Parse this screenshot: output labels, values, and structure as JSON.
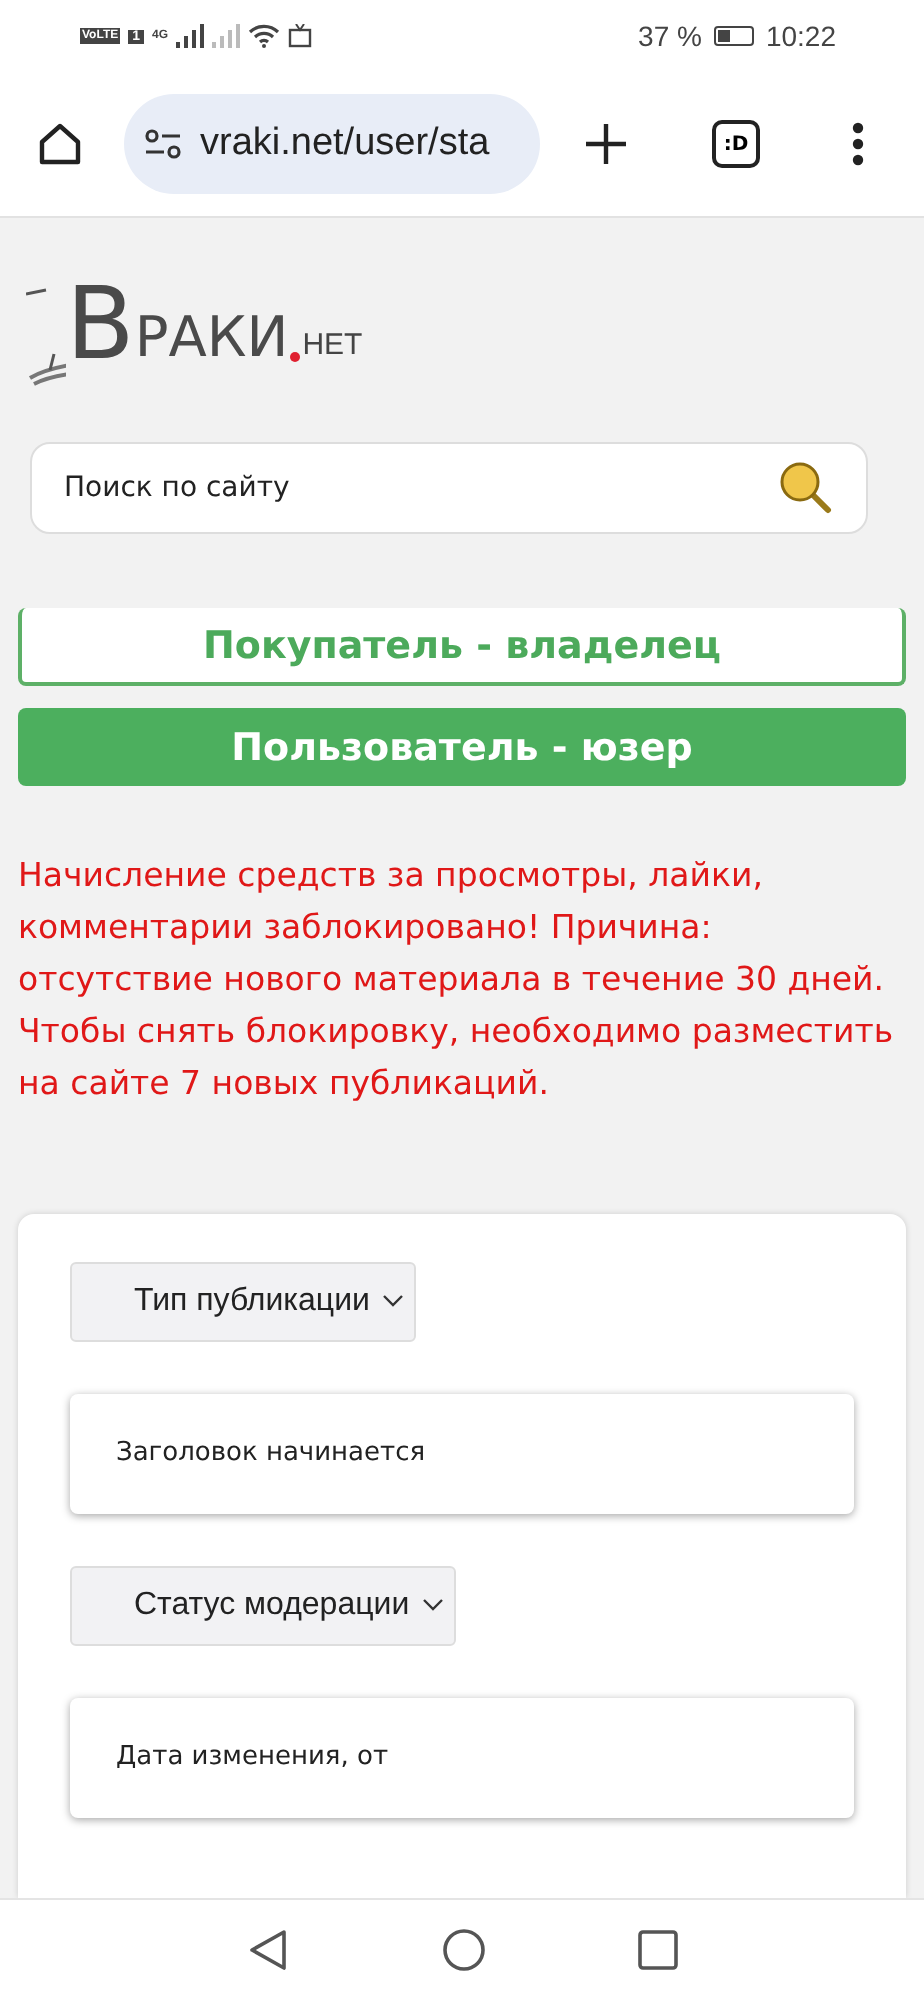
{
  "status_bar": {
    "network_labels": [
      "VoLTE",
      "1",
      "4G"
    ],
    "battery_percent": "37 %",
    "time": "10:22"
  },
  "browser": {
    "url": "vraki.net/user/sta",
    "tab_count": ":D"
  },
  "logo": {
    "initial": "В",
    "name": "РАКИ",
    "tld": "НЕТ"
  },
  "search": {
    "placeholder": "Поиск по сайту"
  },
  "tabs": [
    {
      "label": "Покупатель - владелец",
      "selected": false
    },
    {
      "label": "Пользователь - юзер",
      "selected": true
    }
  ],
  "warning": "Начисление средств за просмотры, лайки, комментарии заблокировано! Причина: отсутствие нового материала в течение 30 дней. Чтобы снять блокировку, необходимо разместить на сайте 7 новых публикаций.",
  "filters": [
    {
      "kind": "select",
      "label": "Тип публикации"
    },
    {
      "kind": "field",
      "placeholder": "Заголовок начинается"
    },
    {
      "kind": "select",
      "label": "Статус модерации"
    },
    {
      "kind": "field",
      "placeholder": "Дата изменения, от"
    }
  ]
}
